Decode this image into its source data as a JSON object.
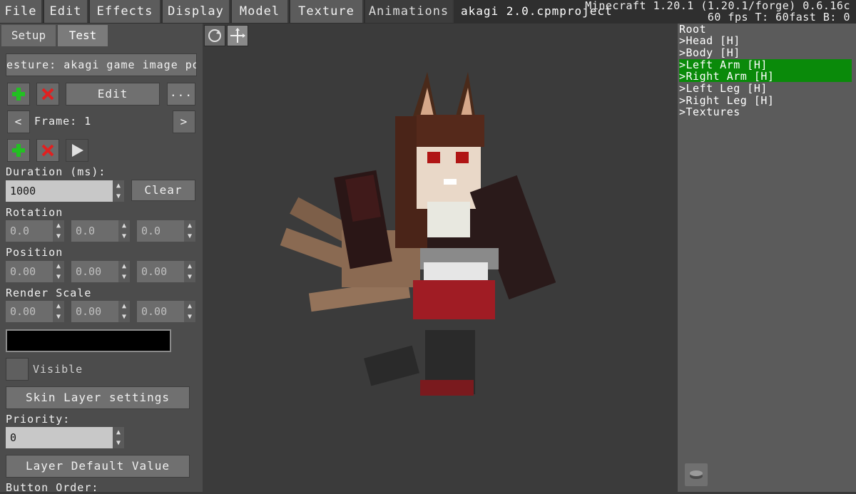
{
  "menu": {
    "items": [
      "File",
      "Edit",
      "Effects",
      "Display",
      "Model",
      "Texture",
      "Animations"
    ],
    "active": "Animations"
  },
  "document_title": "akagi 2.0.cpmproject",
  "status": {
    "version": "Minecraft 1.20.1 (1.20.1/forge) 0.6.16c",
    "perf": "60 fps T: 60fast B: 0"
  },
  "left_panel": {
    "tabs": [
      "Setup",
      "Test"
    ],
    "gesture_label": "esture: akagi game image pos",
    "edit_label": "Edit",
    "more_label": "...",
    "frame_label": "Frame: 1",
    "duration_label": "Duration (ms):",
    "duration_value": "1000",
    "clear_label": "Clear",
    "rotation_label": "Rotation",
    "rotation_values": [
      "0.0",
      "0.0",
      "0.0"
    ],
    "position_label": "Position",
    "position_values": [
      "0.00",
      "0.00",
      "0.00"
    ],
    "render_scale_label": "Render Scale",
    "render_scale_values": [
      "0.00",
      "0.00",
      "0.00"
    ],
    "color_swatch": "#000000",
    "visible_label": "Visible",
    "skin_layer_label": "Skin Layer settings",
    "priority_label": "Priority:",
    "priority_value": "0",
    "layer_default_label": "Layer Default Value",
    "button_order_label": "Button Order:"
  },
  "tree": {
    "root": "Root",
    "items": [
      {
        "label": "Head [H]",
        "selected": false
      },
      {
        "label": "Body [H]",
        "selected": false
      },
      {
        "label": "Left Arm [H]",
        "selected": true
      },
      {
        "label": "Right Arm [H]",
        "selected": true
      },
      {
        "label": "Left Leg [H]",
        "selected": false
      },
      {
        "label": "Right Leg [H]",
        "selected": false
      },
      {
        "label": "Textures",
        "selected": false
      }
    ]
  },
  "icons": {
    "add": "plus-icon",
    "delete": "x-icon",
    "play": "play-icon",
    "rotate_view": "rotate-icon",
    "move_view": "move-icon",
    "layers": "layers-icon"
  },
  "colors": {
    "selection": "#0a8a0a",
    "add": "#22c022",
    "delete": "#e02020"
  }
}
